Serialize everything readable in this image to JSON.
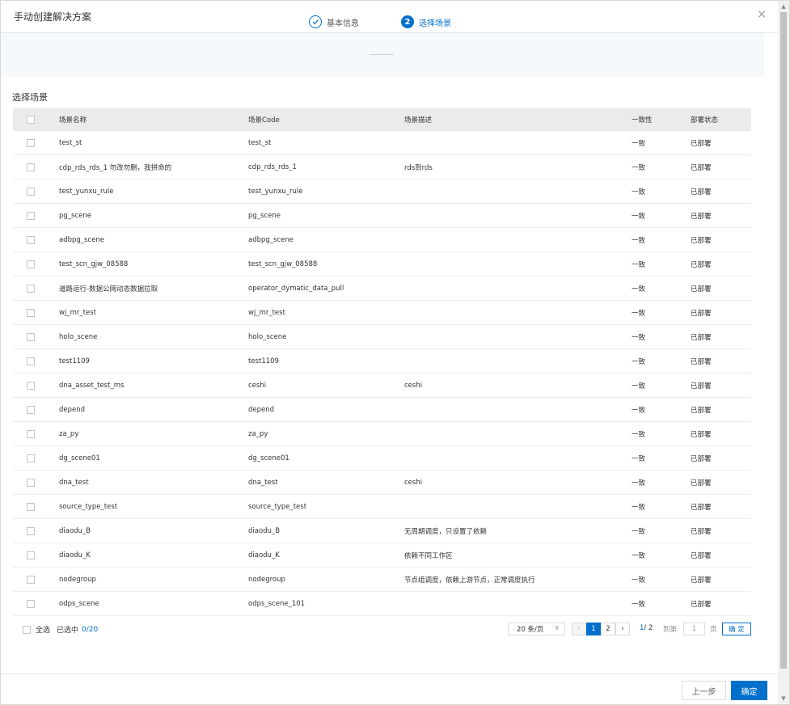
{
  "dialog": {
    "title": "手动创建解决方案",
    "close_icon": "×"
  },
  "steps": [
    {
      "label": "基本信息",
      "icon": "✓"
    },
    {
      "label": "选择场景",
      "number": "2"
    }
  ],
  "section_title": "选择场景",
  "table": {
    "columns": [
      "场景名称",
      "场景Code",
      "场景描述",
      "一致性",
      "部署状态"
    ],
    "rows": [
      {
        "name": "test_st",
        "code": "test_st",
        "desc": "",
        "consistency": "一致",
        "status": "已部署"
      },
      {
        "name": "cdp_rds_rds_1 勿改勿删，我拼命的",
        "code": "cdp_rds_rds_1",
        "desc": "rds到rds",
        "consistency": "一致",
        "status": "已部署"
      },
      {
        "name": "test_yunxu_rule",
        "code": "test_yunxu_rule",
        "desc": "",
        "consistency": "一致",
        "status": "已部署"
      },
      {
        "name": "pg_scene",
        "code": "pg_scene",
        "desc": "",
        "consistency": "一致",
        "status": "已部署"
      },
      {
        "name": "adbpg_scene",
        "code": "adbpg_scene",
        "desc": "",
        "consistency": "一致",
        "status": "已部署"
      },
      {
        "name": "test_scn_gjw_08588",
        "code": "test_scn_gjw_08588",
        "desc": "",
        "consistency": "一致",
        "status": "已部署"
      },
      {
        "name": "道路运行-数据公网动态数据拉取",
        "code": "operator_dymatic_data_pull",
        "desc": "",
        "consistency": "一致",
        "status": "已部署"
      },
      {
        "name": "wj_mr_test",
        "code": "wj_mr_test",
        "desc": "",
        "consistency": "一致",
        "status": "已部署"
      },
      {
        "name": "holo_scene",
        "code": "holo_scene",
        "desc": "",
        "consistency": "一致",
        "status": "已部署"
      },
      {
        "name": "test1109",
        "code": "test1109",
        "desc": "",
        "consistency": "一致",
        "status": "已部署"
      },
      {
        "name": "dna_asset_test_ms",
        "code": "ceshi",
        "desc": "ceshi",
        "consistency": "一致",
        "status": "已部署"
      },
      {
        "name": "depend",
        "code": "depend",
        "desc": "",
        "consistency": "一致",
        "status": "已部署"
      },
      {
        "name": "za_py",
        "code": "za_py",
        "desc": "",
        "consistency": "一致",
        "status": "已部署"
      },
      {
        "name": "dg_scene01",
        "code": "dg_scene01",
        "desc": "",
        "consistency": "一致",
        "status": "已部署"
      },
      {
        "name": "dna_test",
        "code": "dna_test",
        "desc": "ceshi",
        "consistency": "一致",
        "status": "已部署"
      },
      {
        "name": "source_type_test",
        "code": "source_type_test",
        "desc": "",
        "consistency": "一致",
        "status": "已部署"
      },
      {
        "name": "diaodu_B",
        "code": "diaodu_B",
        "desc": "无周期调度，只设置了依赖",
        "consistency": "一致",
        "status": "已部署"
      },
      {
        "name": "diaodu_K",
        "code": "diaodu_K",
        "desc": "依赖不同工作区",
        "consistency": "一致",
        "status": "已部署"
      },
      {
        "name": "nodegroup",
        "code": "nodegroup",
        "desc": "节点组调度，依赖上游节点，正常调度执行",
        "consistency": "一致",
        "status": "已部署"
      },
      {
        "name": "odps_scene",
        "code": "odps_scene_101",
        "desc": "",
        "consistency": "一致",
        "status": "已部署"
      }
    ]
  },
  "footer": {
    "select_all": "全选",
    "selected_label": "已选中",
    "selected_count": "0/20",
    "page_size": "20 条/页",
    "pages": [
      "1",
      "2"
    ],
    "prev_icon": "‹",
    "next_icon": "›",
    "dropdown_icon": "∨",
    "page_info_current": "1",
    "page_info_total": "/ 2",
    "goto_label": "到第",
    "goto_value": "1",
    "page_unit": "页",
    "goto_button": "确 定"
  },
  "actions": {
    "prev": "上一步",
    "ok": "确定"
  },
  "scrollbar": {
    "up_icon": "▲",
    "down_icon": "▼"
  },
  "colors": {
    "accent": "#0070cc",
    "header_bg": "#ebebeb",
    "steps_bg": "#f5f9fc"
  }
}
